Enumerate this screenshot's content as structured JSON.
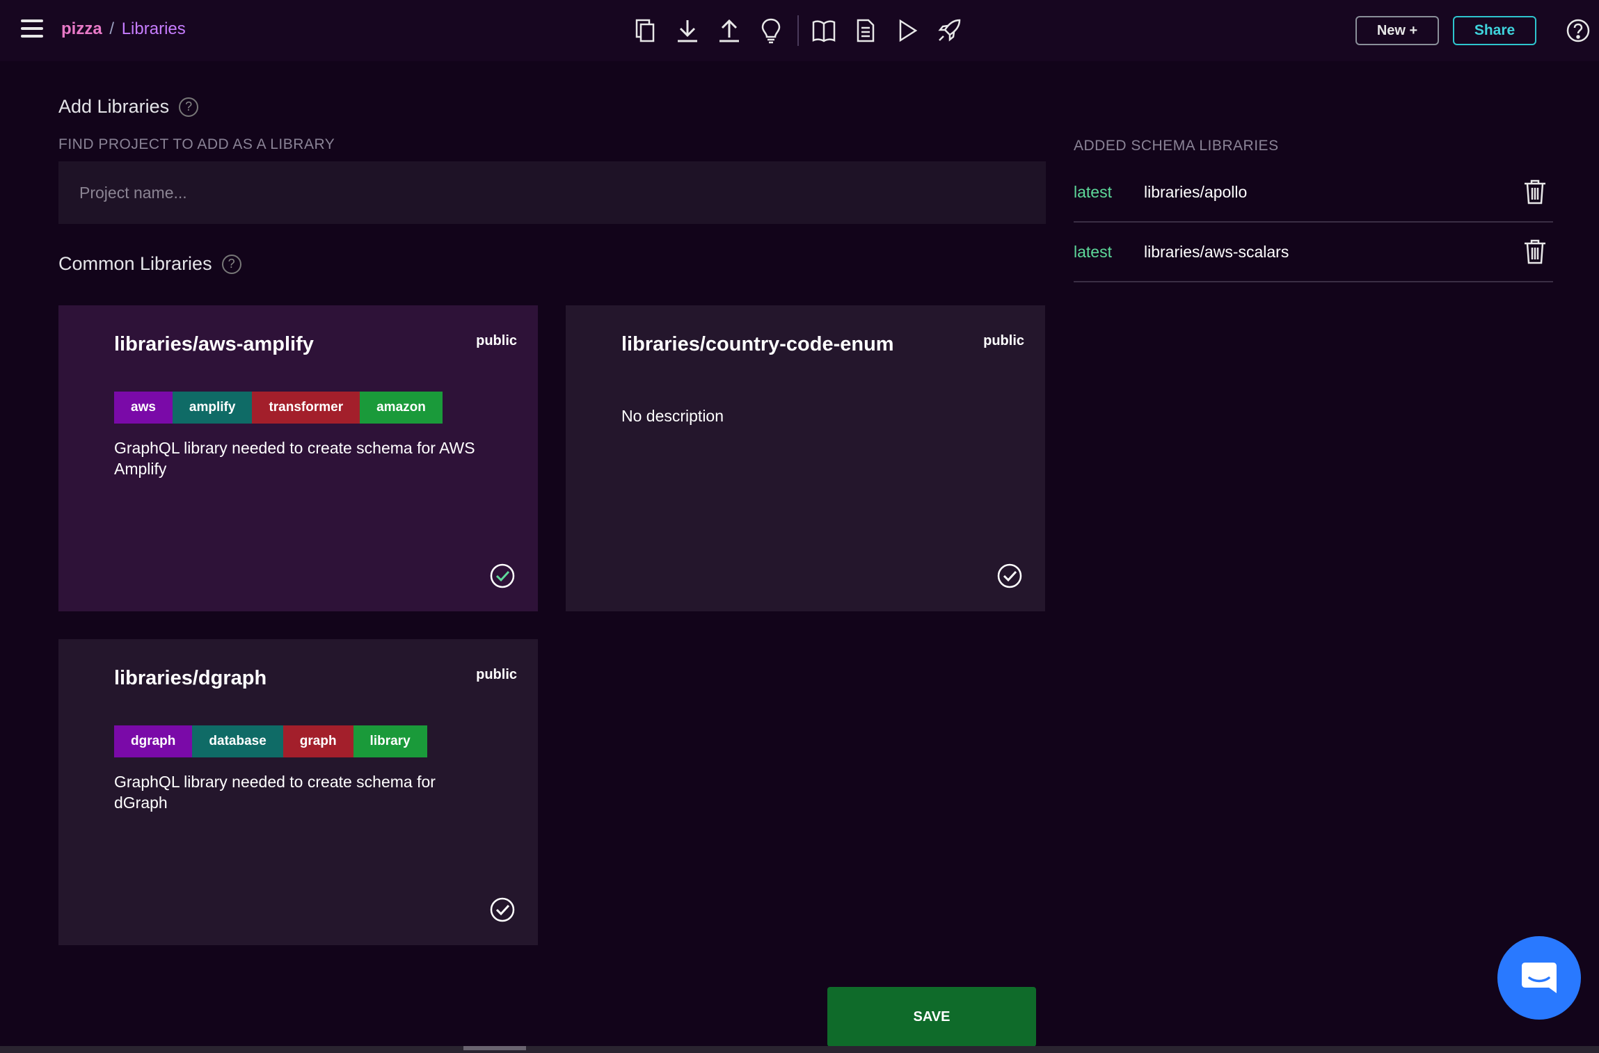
{
  "header": {
    "project": "pizza",
    "separator": "/",
    "page": "Libraries",
    "new_label": "New +",
    "share_label": "Share"
  },
  "toolbar": {
    "icons": [
      "copy-icon",
      "download-icon",
      "upload-icon",
      "lightbulb-icon",
      "book-icon",
      "document-icon",
      "play-icon",
      "rocket-icon"
    ]
  },
  "add_libraries": {
    "title": "Add Libraries",
    "find_label": "FIND PROJECT TO ADD AS A LIBRARY",
    "search_placeholder": "Project name..."
  },
  "common_libraries": {
    "title": "Common Libraries",
    "cards": [
      {
        "name": "libraries/aws-amplify",
        "visibility": "public",
        "tags": [
          {
            "label": "aws",
            "color": "#7a0aa8"
          },
          {
            "label": "amplify",
            "color": "#0f6b66"
          },
          {
            "label": "transformer",
            "color": "#a31f2b"
          },
          {
            "label": "amazon",
            "color": "#1a9a3a"
          }
        ],
        "description": "GraphQL library needed to create schema for AWS Amplify",
        "selected": true
      },
      {
        "name": "libraries/country-code-enum",
        "visibility": "public",
        "tags": [],
        "description": "No description",
        "selected": false
      },
      {
        "name": "libraries/dgraph",
        "visibility": "public",
        "tags": [
          {
            "label": "dgraph",
            "color": "#7a0aa8"
          },
          {
            "label": "database",
            "color": "#0f6b66"
          },
          {
            "label": "graph",
            "color": "#a31f2b"
          },
          {
            "label": "library",
            "color": "#1a9a3a"
          }
        ],
        "description": "GraphQL library needed to create schema for dGraph",
        "selected": false
      }
    ]
  },
  "added_libraries": {
    "title": "ADDED SCHEMA LIBRARIES",
    "items": [
      {
        "version": "latest",
        "name": "libraries/apollo"
      },
      {
        "version": "latest",
        "name": "libraries/aws-scalars"
      }
    ]
  },
  "footer": {
    "save_label": "SAVE"
  },
  "colors": {
    "background": "#12041a",
    "accent_pink": "#e879c7",
    "accent_purple": "#c77dff",
    "share_teal": "#2ec5ce",
    "save_green": "#0f6b2a",
    "version_green": "#5ed99a",
    "chat_blue": "#2979ff"
  }
}
